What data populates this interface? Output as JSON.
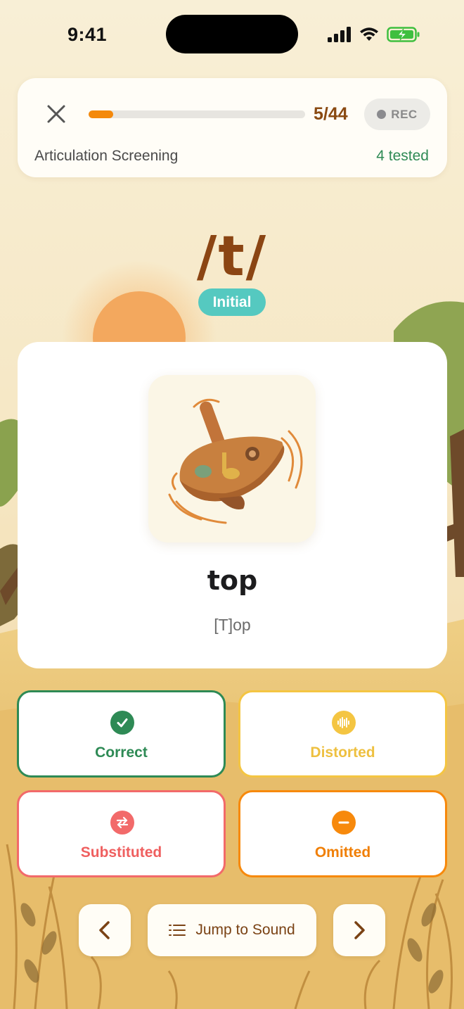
{
  "status_bar": {
    "time": "9:41"
  },
  "header": {
    "progress_current": 5,
    "progress_total": 44,
    "progress_fraction": 0.114,
    "count_label": "5/44",
    "rec_label": "REC",
    "title": "Articulation Screening",
    "tested_label": "4 tested",
    "close_icon": "close-icon"
  },
  "target": {
    "phoneme": "/t/",
    "position": "Initial"
  },
  "word_card": {
    "image": "spinning-top-illustration",
    "word": "top",
    "transcription": "[T]op"
  },
  "ratings": {
    "correct": {
      "label": "Correct",
      "icon": "check-icon",
      "color": "#2e8a55"
    },
    "distorted": {
      "label": "Distorted",
      "icon": "waveform-icon",
      "color": "#f4c542"
    },
    "substituted": {
      "label": "Substituted",
      "icon": "swap-icon",
      "color": "#f26a6a"
    },
    "omitted": {
      "label": "Omitted",
      "icon": "minus-icon",
      "color": "#f7890c"
    }
  },
  "navigation": {
    "jump_label": "Jump to Sound",
    "prev_icon": "chevron-left-icon",
    "next_icon": "chevron-right-icon",
    "jump_icon": "list-icon"
  },
  "colors": {
    "accent_orange": "#f4890c",
    "brown": "#8b4513",
    "teal": "#55c9c0",
    "background": "#f7ecd0"
  }
}
